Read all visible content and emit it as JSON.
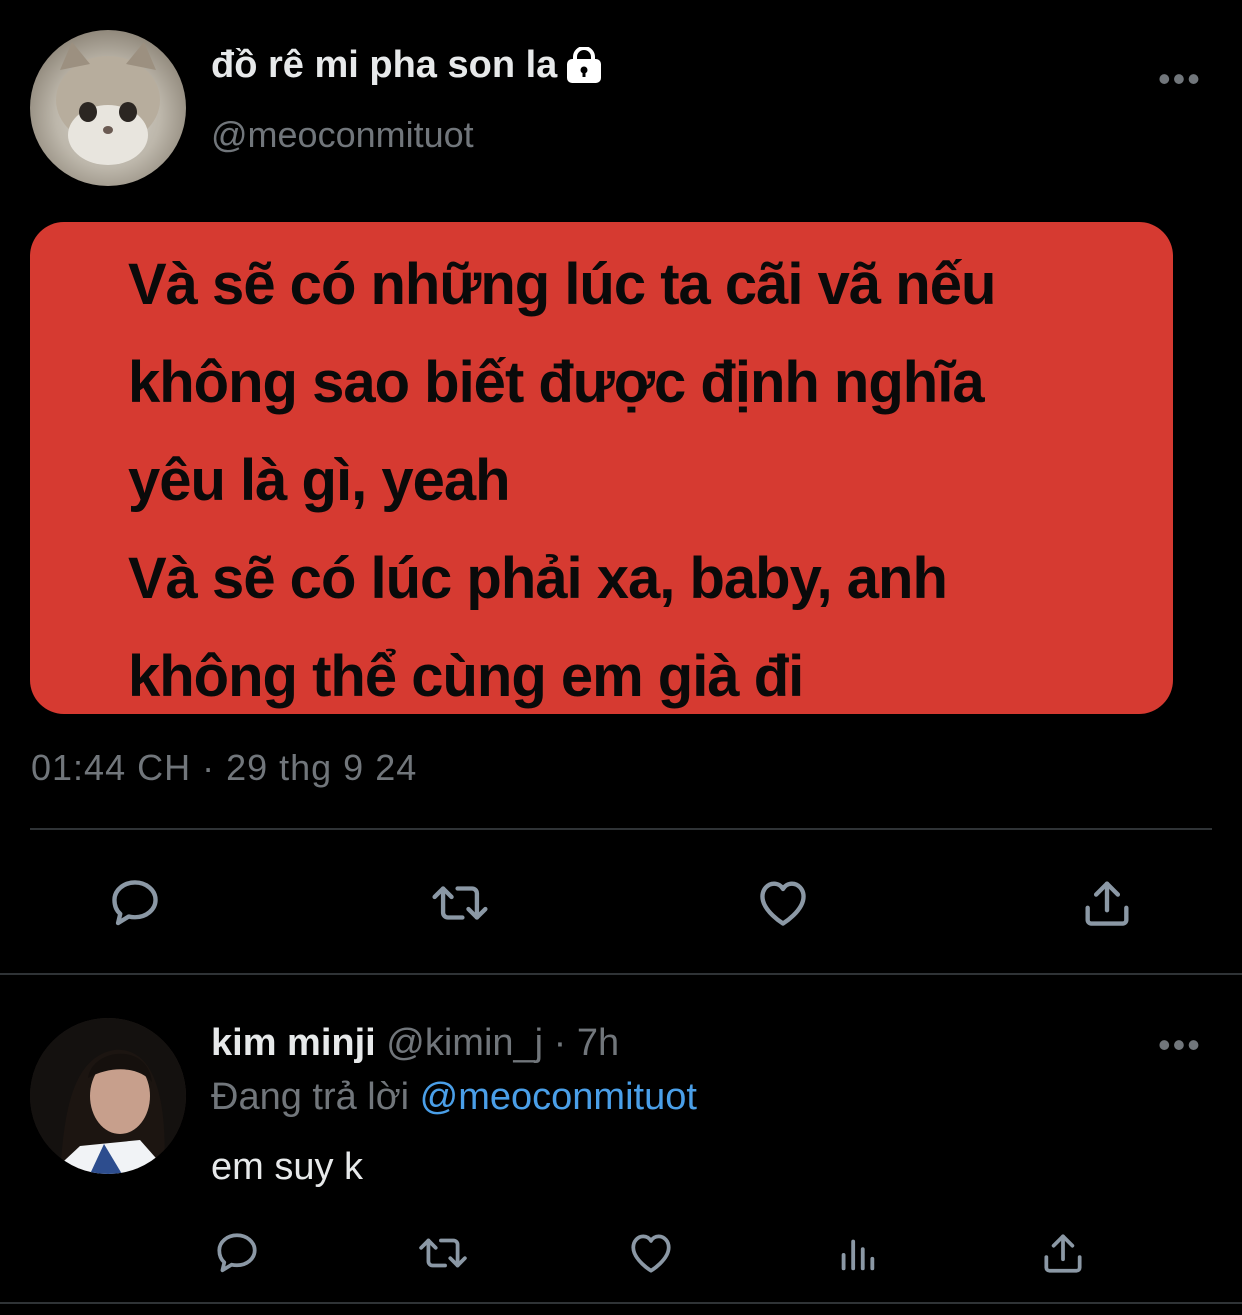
{
  "tweet": {
    "author_name": "đồ rê mi pha son la",
    "author_handle": "@meoconmituot",
    "lyrics": [
      "Và sẽ có những lúc ta cãi vã nếu",
      "không sao biết được định nghĩa",
      "yêu là gì, yeah",
      "Và sẽ có lúc phải xa, baby, anh",
      "không thể cùng em già đi"
    ],
    "card_color": "#d63a31",
    "timestamp": "01:44 CH · 29 thg 9 24",
    "actions": [
      "reply-icon",
      "retweet-icon",
      "like-icon",
      "share-icon"
    ],
    "more_icon": "•••"
  },
  "reply": {
    "author_name": "kim minji",
    "author_handle": "@kimin_j",
    "separator": " · ",
    "time": "7h",
    "replying_prefix": "Đang trả lời ",
    "replying_to": "@meoconmituot",
    "text": "em suy k",
    "more_icon": "•••",
    "actions": [
      "reply-icon",
      "retweet-icon",
      "like-icon",
      "analytics-icon",
      "share-icon"
    ]
  },
  "colors": {
    "background": "#000000",
    "text_primary": "#e7e9ea",
    "text_secondary": "#71767b",
    "link": "#4a9fe8",
    "divider": "#2f3336"
  }
}
